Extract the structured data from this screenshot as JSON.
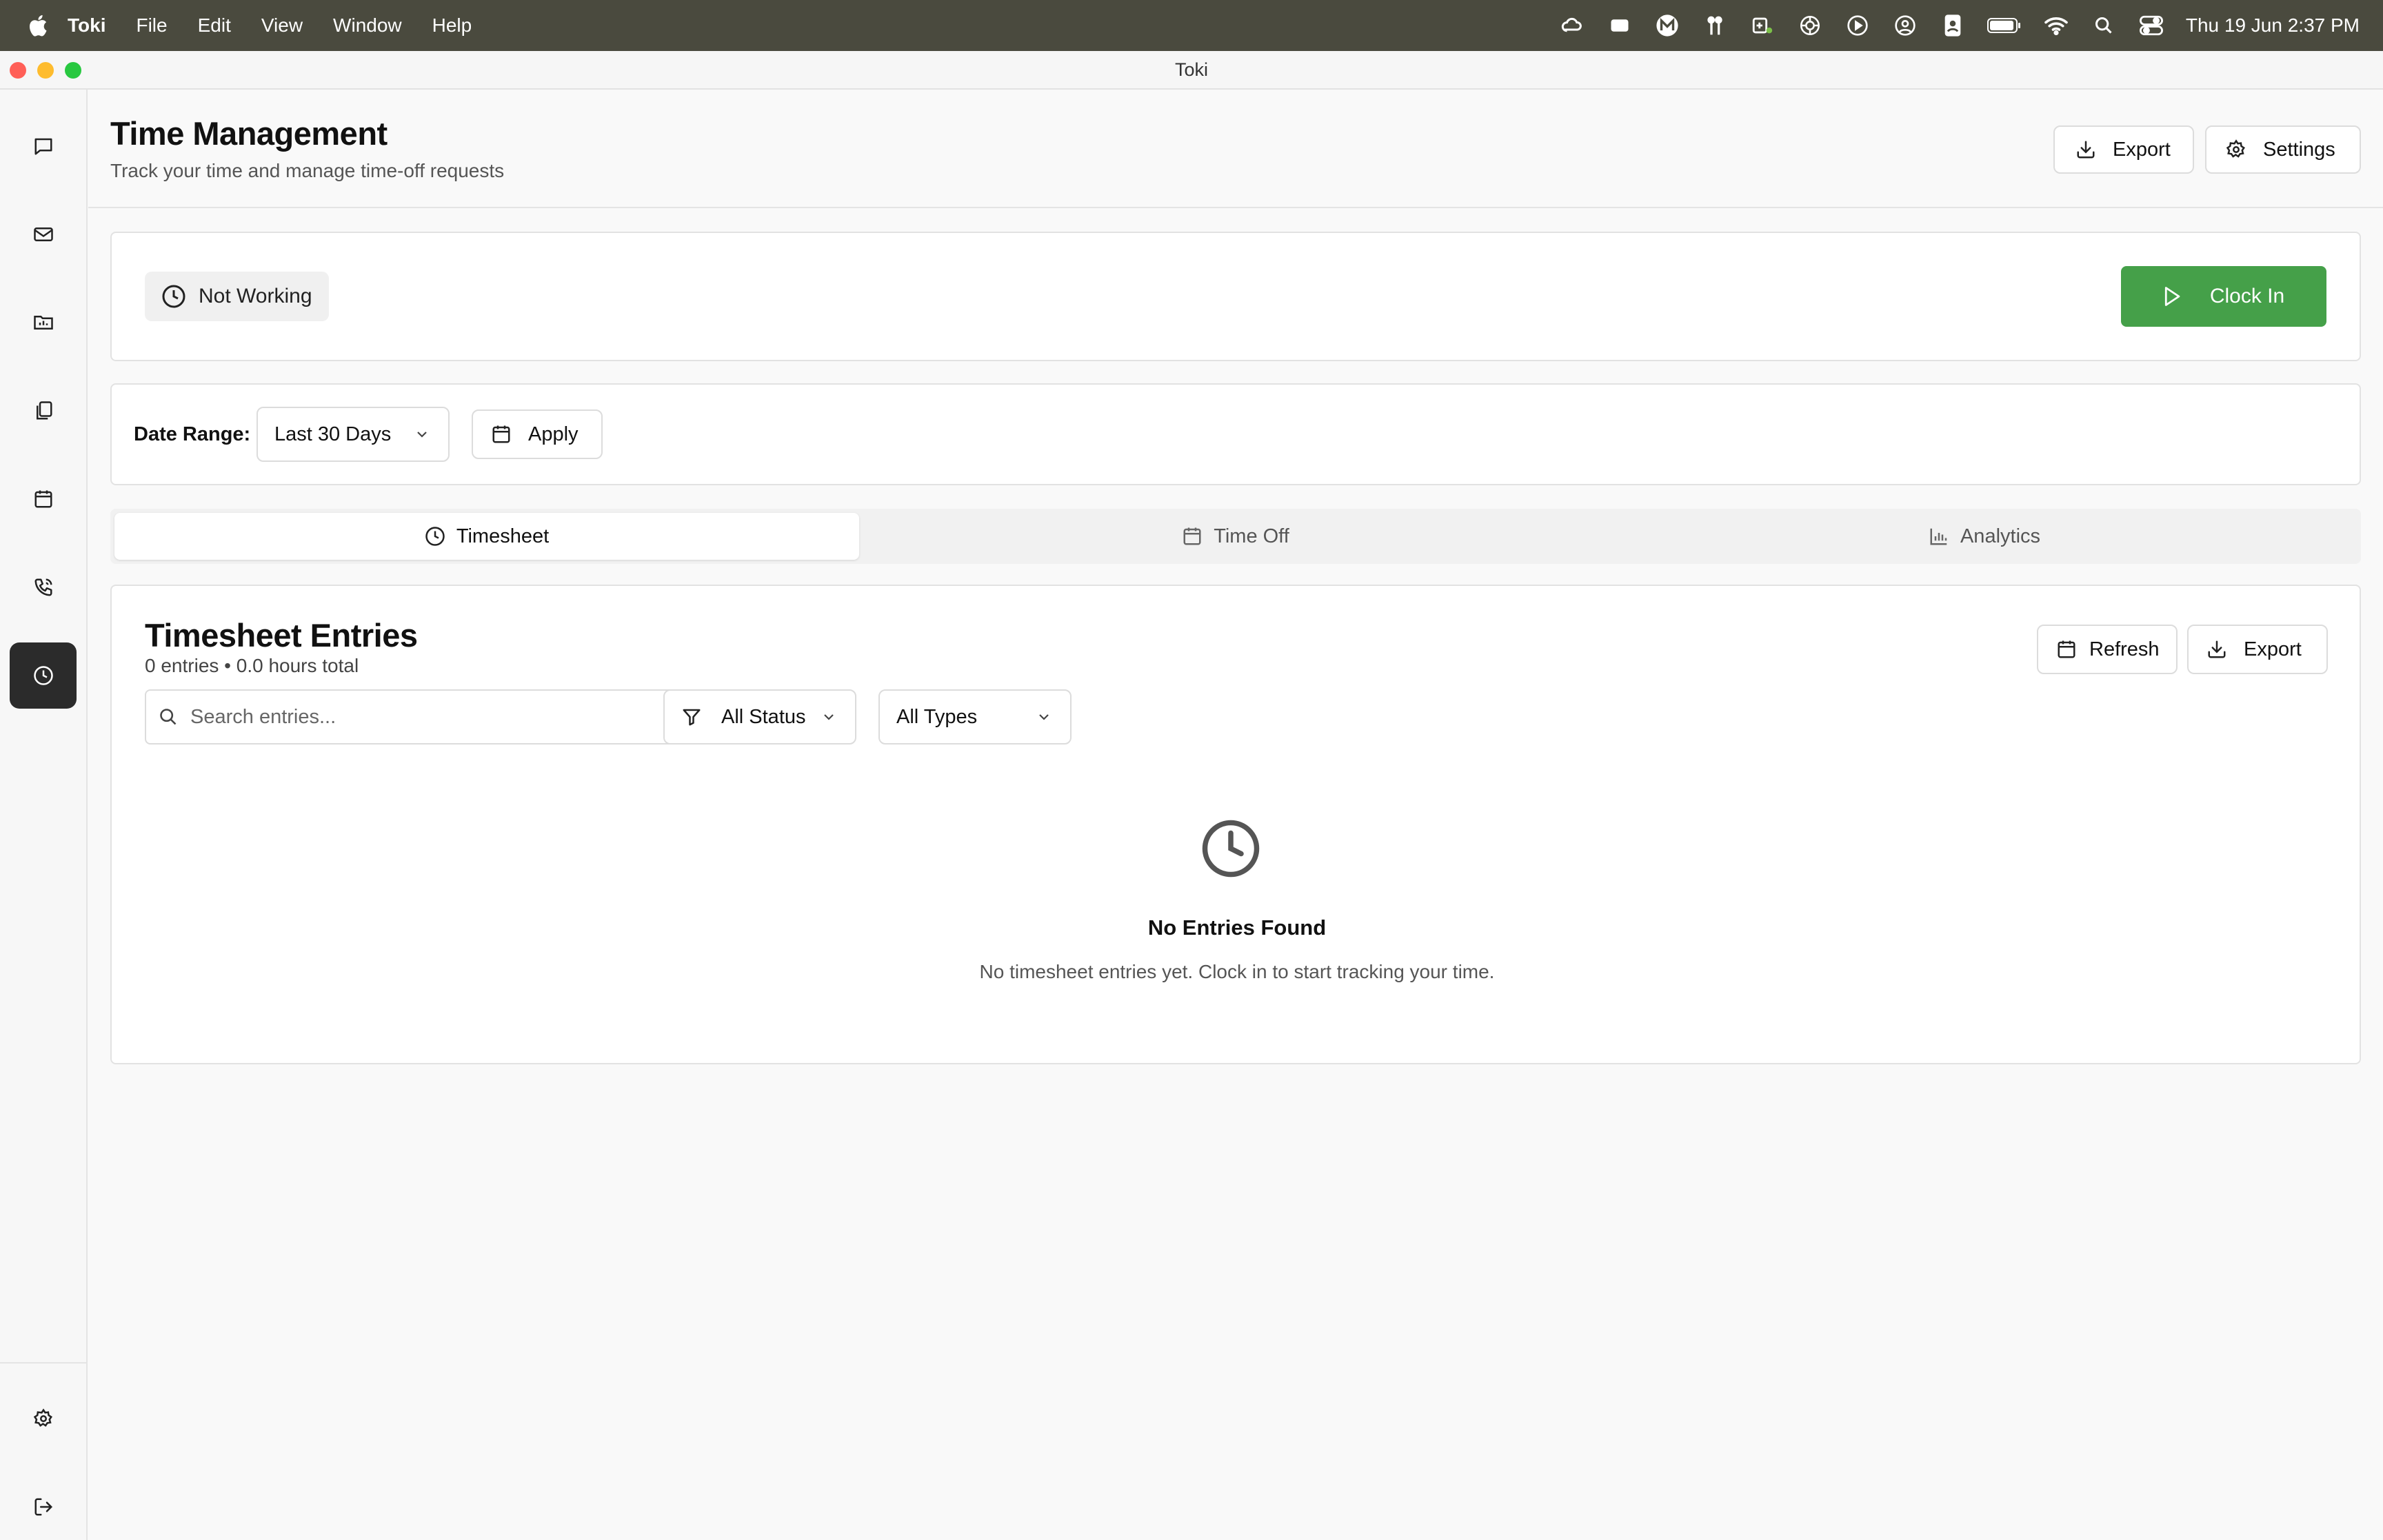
{
  "menubar": {
    "app_name": "Toki",
    "menus": [
      "File",
      "Edit",
      "View",
      "Window",
      "Help"
    ],
    "datetime": "Thu 19 Jun  2:37 PM"
  },
  "window": {
    "title": "Toki"
  },
  "sidebar": {
    "items": [
      {
        "icon": "chat-icon",
        "active": false
      },
      {
        "icon": "mail-icon",
        "active": false
      },
      {
        "icon": "folder-icon",
        "active": false
      },
      {
        "icon": "documents-icon",
        "active": false
      },
      {
        "icon": "calendar-icon",
        "active": false
      },
      {
        "icon": "phone-icon",
        "active": false
      },
      {
        "icon": "clock-icon",
        "active": true
      }
    ],
    "bottom_items": [
      {
        "icon": "gear-icon"
      },
      {
        "icon": "logout-icon"
      }
    ]
  },
  "header": {
    "title": "Time Management",
    "subtitle": "Track your time and manage time-off requests",
    "export_label": "Export",
    "settings_label": "Settings"
  },
  "status_card": {
    "status": "Not Working",
    "clock_in_label": "Clock In",
    "accent": "#45a049"
  },
  "date_filter": {
    "label": "Date Range:",
    "selected": "Last 30 Days",
    "apply_label": "Apply"
  },
  "tabs": [
    {
      "label": "Timesheet",
      "icon": "clock-icon",
      "active": true
    },
    {
      "label": "Time Off",
      "icon": "calendar-icon",
      "active": false
    },
    {
      "label": "Analytics",
      "icon": "bar-chart-icon",
      "active": false
    }
  ],
  "timesheet": {
    "title": "Timesheet Entries",
    "summary": "0 entries • 0.0 hours total",
    "refresh_label": "Refresh",
    "export_label": "Export",
    "search_placeholder": "Search entries...",
    "status_filter": "All Status",
    "type_filter": "All Types",
    "empty_title": "No Entries Found",
    "empty_text": "No timesheet entries yet. Clock in to start tracking your time."
  }
}
